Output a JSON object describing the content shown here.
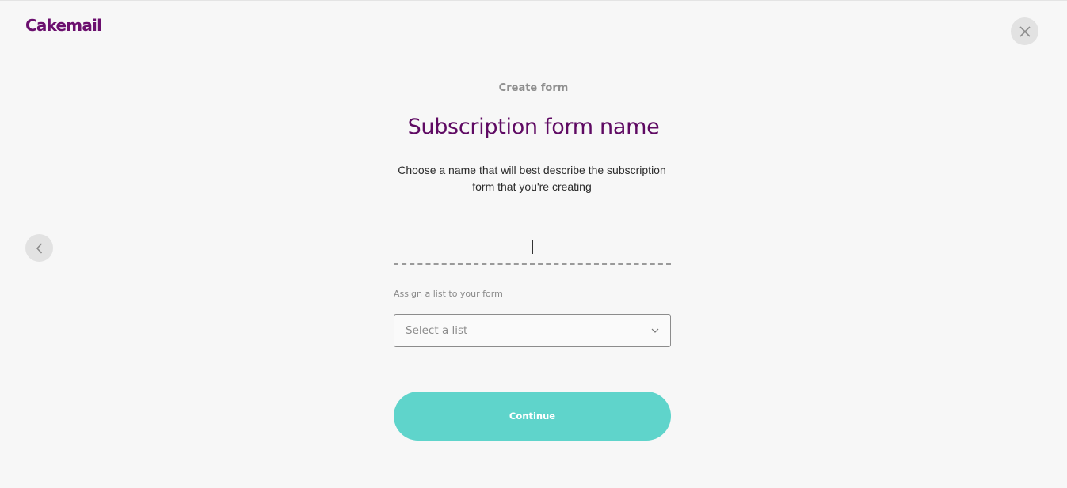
{
  "header": {
    "logo_text": "Cakemail"
  },
  "icons": {
    "close": "close-icon",
    "back": "chevron-left-icon",
    "dropdown": "chevron-down-icon"
  },
  "form": {
    "step_label": "Create form",
    "title": "Subscription form name",
    "description": "Choose a name that will best describe the subscription form that you're creating",
    "name_value": "",
    "assign_label": "Assign a list to your form",
    "select_value": "Select a list",
    "continue_label": "Continue"
  },
  "colors": {
    "brand": "#6b0f6e",
    "title": "#5f0a63",
    "accent": "#5fd4cb",
    "background": "#f7f7f7"
  }
}
